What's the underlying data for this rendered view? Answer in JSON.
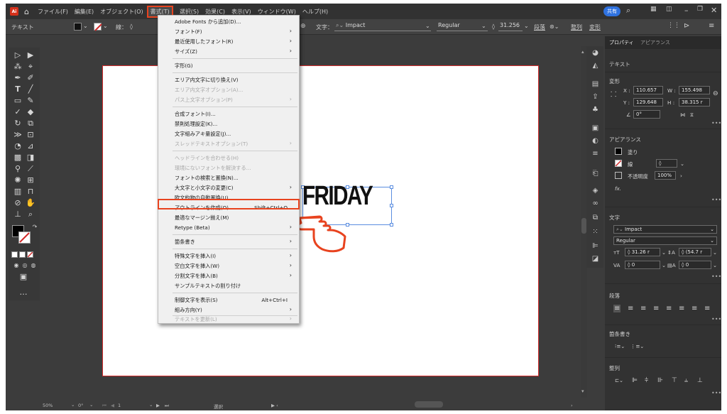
{
  "app": {
    "logo": "Ai",
    "home_icon": "home-icon"
  },
  "menubar": {
    "items": [
      "ファイル(F)",
      "編集(E)",
      "オブジェクト(O)",
      "書式(T)",
      "選択(S)",
      "効果(C)",
      "表示(V)",
      "ウィンドウ(W)",
      "ヘルプ(H)"
    ],
    "share_label": "共有"
  },
  "control_bar": {
    "mode_label": "テキスト",
    "stroke_label": "線：",
    "char_label": "文字：",
    "font_family": "Impact",
    "font_style": "Regular",
    "font_size": "31.256",
    "paragraph_label": "段落",
    "align_label": "整列",
    "transform_label": "変形"
  },
  "artboard": {
    "text": "FRIDAY"
  },
  "type_menu": {
    "items": [
      {
        "label": "Adobe Fonts から追加(D)...",
        "enabled": true
      },
      {
        "label": "フォント(F)",
        "enabled": true,
        "submenu": true
      },
      {
        "label": "最近使用したフォント(R)",
        "enabled": true,
        "submenu": true
      },
      {
        "label": "サイズ(Z)",
        "enabled": true,
        "submenu": true
      },
      {
        "label": "字形(G)",
        "enabled": true
      },
      {
        "label": "エリア内文字に切り換え(V)",
        "enabled": true
      },
      {
        "label": "エリア内文字オプション(A)...",
        "enabled": false
      },
      {
        "label": "パス上文字オプション(P)",
        "enabled": false,
        "submenu": true
      },
      {
        "label": "合成フォント(I)...",
        "enabled": true
      },
      {
        "label": "禁則処理設定(K)...",
        "enabled": true
      },
      {
        "label": "文字組みアキ量設定(J)...",
        "enabled": true
      },
      {
        "label": "スレッドテキストオプション(T)",
        "enabled": false,
        "submenu": true
      },
      {
        "label": "ヘッドラインを合わせる(H)",
        "enabled": false
      },
      {
        "label": "環境にないフォントを解決する...",
        "enabled": false
      },
      {
        "label": "フォントの検索と置換(N)...",
        "enabled": true
      },
      {
        "label": "大文字と小文字の変更(C)",
        "enabled": true,
        "submenu": true
      },
      {
        "label": "欧文約物の自動置換(U)...",
        "enabled": true
      },
      {
        "label": "アウトラインを作成(O)",
        "enabled": true,
        "shortcut": "Shift+Ctrl+O",
        "highlighted": true
      },
      {
        "label": "最適なマージン揃え(M)",
        "enabled": true
      },
      {
        "label": "Retype (Beta)",
        "enabled": true,
        "submenu": true
      },
      {
        "label": "箇条書き",
        "enabled": true,
        "submenu": true
      },
      {
        "label": "特殊文字を挿入(I)",
        "enabled": true,
        "submenu": true
      },
      {
        "label": "空白文字を挿入(W)",
        "enabled": true,
        "submenu": true
      },
      {
        "label": "分割文字を挿入(B)",
        "enabled": true,
        "submenu": true
      },
      {
        "label": "サンプルテキストの割り付け",
        "enabled": true
      },
      {
        "label": "制御文字を表示(S)",
        "enabled": true,
        "shortcut": "Alt+Ctrl+I"
      },
      {
        "label": "組み方向(Y)",
        "enabled": true,
        "submenu": true
      },
      {
        "label": "テキストを更新(L)",
        "enabled": false,
        "submenu": true
      }
    ]
  },
  "properties": {
    "tabs": [
      "プロパティ",
      "アピアランス"
    ],
    "selection_type": "テキスト",
    "transform": {
      "title": "変形",
      "x": "110.657",
      "y": "129.648",
      "w": "155.498",
      "h": "38.315 r",
      "angle": "0°"
    },
    "appearance": {
      "title": "アピアランス",
      "fill_label": "塗り",
      "stroke_label": "線",
      "opacity_label": "不透明度",
      "opacity": "100%",
      "fx": "fx."
    },
    "character": {
      "title": "文字",
      "font": "Impact",
      "style": "Regular",
      "size": "31.26 r",
      "leading": "(54.7 r",
      "tracking": "0",
      "kerning": "0"
    },
    "paragraph_title": "段落",
    "bullets_title": "箇条書き",
    "align_title": "整列"
  },
  "status_bar": {
    "zoom": "50%",
    "angle": "0°",
    "page": "1",
    "tool": "選択"
  }
}
